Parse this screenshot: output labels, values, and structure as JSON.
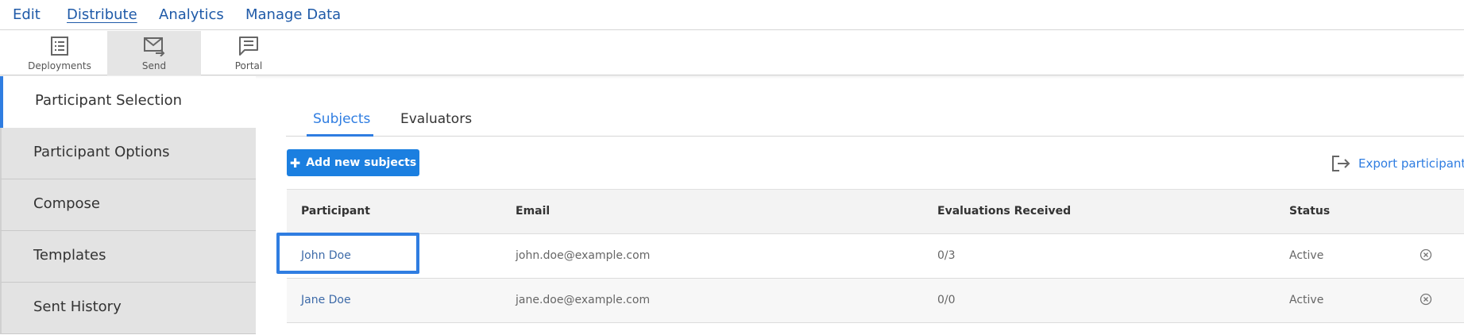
{
  "top_menu": [
    {
      "label": "Edit",
      "active": false
    },
    {
      "label": "Distribute",
      "active": true
    },
    {
      "label": "Analytics",
      "active": false
    },
    {
      "label": "Manage Data",
      "active": false
    }
  ],
  "toolbar": [
    {
      "label": "Deployments",
      "icon": "list-icon",
      "active": false
    },
    {
      "label": "Send",
      "icon": "mail-send-icon",
      "active": true
    },
    {
      "label": "Portal",
      "icon": "chat-icon",
      "active": false
    }
  ],
  "sidebar": [
    {
      "label": "Participant Selection",
      "active": true
    },
    {
      "label": "Participant Options",
      "active": false
    },
    {
      "label": "Compose",
      "active": false
    },
    {
      "label": "Templates",
      "active": false
    },
    {
      "label": "Sent History",
      "active": false
    }
  ],
  "tabs": [
    {
      "label": "Subjects",
      "active": true
    },
    {
      "label": "Evaluators",
      "active": false
    }
  ],
  "add_button": {
    "label": "Add new subjects",
    "icon": "plus-icon"
  },
  "export": {
    "label": "Export participants",
    "icon": "export-icon"
  },
  "table": {
    "headers": [
      "Participant",
      "Email",
      "Evaluations Received",
      "Status"
    ],
    "rows": [
      {
        "participant": "John Doe",
        "email": "john.doe@example.com",
        "evaluations": "0/3",
        "status": "Active"
      },
      {
        "participant": "Jane Doe",
        "email": "jane.doe@example.com",
        "evaluations": "0/0",
        "status": "Active"
      }
    ]
  },
  "colors": {
    "accent": "#2f7de1",
    "button": "#1b7fe0",
    "link": "#1f5aa8"
  }
}
